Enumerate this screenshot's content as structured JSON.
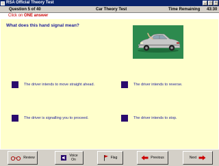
{
  "window": {
    "title": "RSA Official Theory Test",
    "buttons": [
      "_",
      "□",
      "×"
    ]
  },
  "header": {
    "question_counter": "Question 5 of 40",
    "test_name": "Car Theory Test",
    "time_label": "Time Remaining",
    "time_value": "43:30"
  },
  "instruction": {
    "prefix": "Click on ",
    "emphasis": "ONE answer"
  },
  "question": {
    "text": "What does this hand signal mean?"
  },
  "picture": {
    "background_color": "#2d8a4e",
    "car_color": "#c8c8c8"
  },
  "answers": [
    {
      "text": "The driver intends to move straight ahead."
    },
    {
      "text": "The driver intends to reverse."
    },
    {
      "text": "The driver is signalling you to proceed."
    },
    {
      "text": "The driver intends to stop."
    }
  ],
  "toolbar": {
    "review_label": "Review",
    "voice_line1": "Voice",
    "voice_line2": "On",
    "flag_label": "Flag",
    "previous_label": "Previous",
    "next_label": "Next"
  },
  "colors": {
    "title_bar": "#0a246a",
    "panel_background": "#ffffcc",
    "answer_box": "#2a0a6e",
    "question_text": "#1a1a99",
    "instruction_text": "#cc0000",
    "arrow_red": "#cc0000"
  },
  "icons": {
    "review": "glasses-icon",
    "voice": "speaker-icon",
    "flag": "flag-icon",
    "previous": "arrow-left-icon",
    "next": "arrow-right-icon"
  }
}
